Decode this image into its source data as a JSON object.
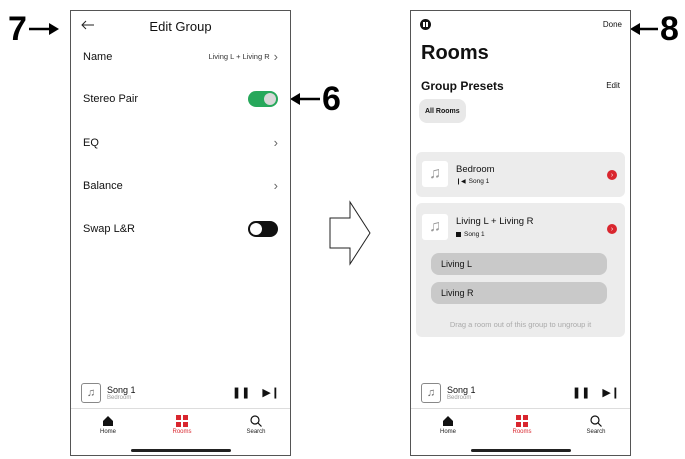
{
  "callouts": {
    "c7": "7",
    "c6": "6",
    "c8": "8"
  },
  "edit_group": {
    "title": "Edit Group",
    "back_icon": "arrow-left-icon",
    "rows": [
      {
        "label": "Name",
        "value": "Living L + Living R"
      },
      {
        "label": "Stereo Pair",
        "toggle": "on"
      },
      {
        "label": "EQ"
      },
      {
        "label": "Balance"
      },
      {
        "label": "Swap L&R",
        "toggle": "off"
      }
    ],
    "toggle_on_color": "#27a85b"
  },
  "rooms": {
    "title": "Rooms",
    "done_label": "Done",
    "presets_title": "Group Presets",
    "edit_label": "Edit",
    "preset_chip": "All Rooms",
    "cards": [
      {
        "name": "Bedroom",
        "song": "Song 1"
      },
      {
        "name": "Living L + Living R",
        "song": "Song 1",
        "members": [
          "Living L",
          "Living R"
        ],
        "hint": "Drag a room out of this group to ungroup it"
      }
    ],
    "accent_color": "#d9262e"
  },
  "now_playing": {
    "title": "Song 1",
    "subtitle": "Bedroom"
  },
  "tabs": [
    {
      "label": "Home",
      "icon": "home-icon"
    },
    {
      "label": "Rooms",
      "icon": "rooms-icon",
      "active": true
    },
    {
      "label": "Search",
      "icon": "search-icon"
    }
  ]
}
